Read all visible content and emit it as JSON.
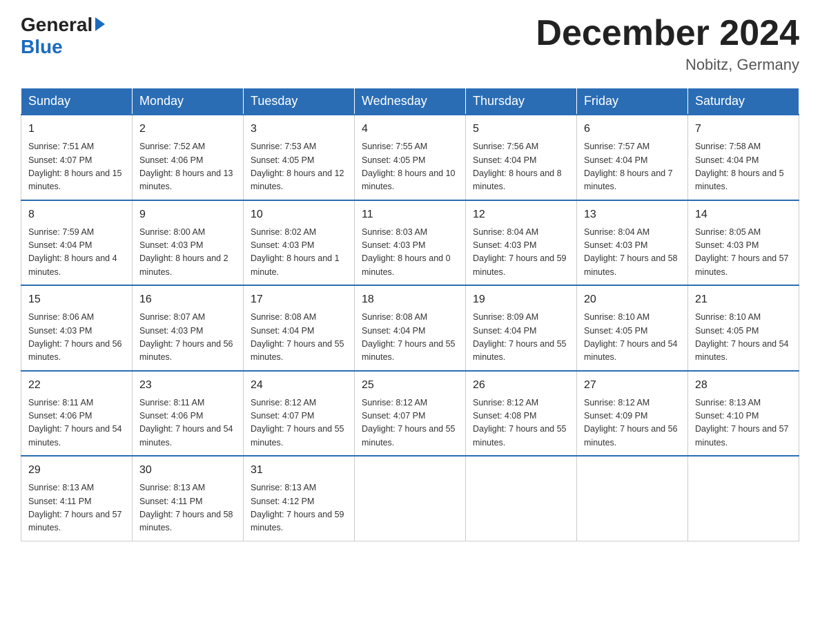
{
  "header": {
    "logo_general": "General",
    "logo_blue": "Blue",
    "month_title": "December 2024",
    "location": "Nobitz, Germany"
  },
  "days_of_week": [
    "Sunday",
    "Monday",
    "Tuesday",
    "Wednesday",
    "Thursday",
    "Friday",
    "Saturday"
  ],
  "weeks": [
    [
      {
        "day": "1",
        "sunrise": "7:51 AM",
        "sunset": "4:07 PM",
        "daylight": "8 hours and 15 minutes."
      },
      {
        "day": "2",
        "sunrise": "7:52 AM",
        "sunset": "4:06 PM",
        "daylight": "8 hours and 13 minutes."
      },
      {
        "day": "3",
        "sunrise": "7:53 AM",
        "sunset": "4:05 PM",
        "daylight": "8 hours and 12 minutes."
      },
      {
        "day": "4",
        "sunrise": "7:55 AM",
        "sunset": "4:05 PM",
        "daylight": "8 hours and 10 minutes."
      },
      {
        "day": "5",
        "sunrise": "7:56 AM",
        "sunset": "4:04 PM",
        "daylight": "8 hours and 8 minutes."
      },
      {
        "day": "6",
        "sunrise": "7:57 AM",
        "sunset": "4:04 PM",
        "daylight": "8 hours and 7 minutes."
      },
      {
        "day": "7",
        "sunrise": "7:58 AM",
        "sunset": "4:04 PM",
        "daylight": "8 hours and 5 minutes."
      }
    ],
    [
      {
        "day": "8",
        "sunrise": "7:59 AM",
        "sunset": "4:04 PM",
        "daylight": "8 hours and 4 minutes."
      },
      {
        "day": "9",
        "sunrise": "8:00 AM",
        "sunset": "4:03 PM",
        "daylight": "8 hours and 2 minutes."
      },
      {
        "day": "10",
        "sunrise": "8:02 AM",
        "sunset": "4:03 PM",
        "daylight": "8 hours and 1 minute."
      },
      {
        "day": "11",
        "sunrise": "8:03 AM",
        "sunset": "4:03 PM",
        "daylight": "8 hours and 0 minutes."
      },
      {
        "day": "12",
        "sunrise": "8:04 AM",
        "sunset": "4:03 PM",
        "daylight": "7 hours and 59 minutes."
      },
      {
        "day": "13",
        "sunrise": "8:04 AM",
        "sunset": "4:03 PM",
        "daylight": "7 hours and 58 minutes."
      },
      {
        "day": "14",
        "sunrise": "8:05 AM",
        "sunset": "4:03 PM",
        "daylight": "7 hours and 57 minutes."
      }
    ],
    [
      {
        "day": "15",
        "sunrise": "8:06 AM",
        "sunset": "4:03 PM",
        "daylight": "7 hours and 56 minutes."
      },
      {
        "day": "16",
        "sunrise": "8:07 AM",
        "sunset": "4:03 PM",
        "daylight": "7 hours and 56 minutes."
      },
      {
        "day": "17",
        "sunrise": "8:08 AM",
        "sunset": "4:04 PM",
        "daylight": "7 hours and 55 minutes."
      },
      {
        "day": "18",
        "sunrise": "8:08 AM",
        "sunset": "4:04 PM",
        "daylight": "7 hours and 55 minutes."
      },
      {
        "day": "19",
        "sunrise": "8:09 AM",
        "sunset": "4:04 PM",
        "daylight": "7 hours and 55 minutes."
      },
      {
        "day": "20",
        "sunrise": "8:10 AM",
        "sunset": "4:05 PM",
        "daylight": "7 hours and 54 minutes."
      },
      {
        "day": "21",
        "sunrise": "8:10 AM",
        "sunset": "4:05 PM",
        "daylight": "7 hours and 54 minutes."
      }
    ],
    [
      {
        "day": "22",
        "sunrise": "8:11 AM",
        "sunset": "4:06 PM",
        "daylight": "7 hours and 54 minutes."
      },
      {
        "day": "23",
        "sunrise": "8:11 AM",
        "sunset": "4:06 PM",
        "daylight": "7 hours and 54 minutes."
      },
      {
        "day": "24",
        "sunrise": "8:12 AM",
        "sunset": "4:07 PM",
        "daylight": "7 hours and 55 minutes."
      },
      {
        "day": "25",
        "sunrise": "8:12 AM",
        "sunset": "4:07 PM",
        "daylight": "7 hours and 55 minutes."
      },
      {
        "day": "26",
        "sunrise": "8:12 AM",
        "sunset": "4:08 PM",
        "daylight": "7 hours and 55 minutes."
      },
      {
        "day": "27",
        "sunrise": "8:12 AM",
        "sunset": "4:09 PM",
        "daylight": "7 hours and 56 minutes."
      },
      {
        "day": "28",
        "sunrise": "8:13 AM",
        "sunset": "4:10 PM",
        "daylight": "7 hours and 57 minutes."
      }
    ],
    [
      {
        "day": "29",
        "sunrise": "8:13 AM",
        "sunset": "4:11 PM",
        "daylight": "7 hours and 57 minutes."
      },
      {
        "day": "30",
        "sunrise": "8:13 AM",
        "sunset": "4:11 PM",
        "daylight": "7 hours and 58 minutes."
      },
      {
        "day": "31",
        "sunrise": "8:13 AM",
        "sunset": "4:12 PM",
        "daylight": "7 hours and 59 minutes."
      },
      null,
      null,
      null,
      null
    ]
  ]
}
